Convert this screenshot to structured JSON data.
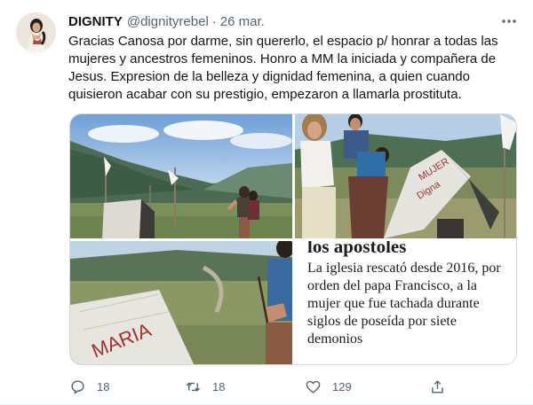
{
  "tweet": {
    "author_name": "DIGNITY",
    "author_handle": "@dignityrebel",
    "separator": "·",
    "date": "26 mar.",
    "text": "Gracias Canosa por darme, sin quererlo, el espacio p/ honrar a todas las\nmujeres y ancestros femeninos. Honro a MM la iniciada y compañera de\nJesus. Expresion de la belleza y dignidad femenina, a quien cuando\nquisieron acabar con su prestigio, empezaron a llamarla prostituta."
  },
  "media": {
    "photo2_sign_text": [
      "MUJER",
      "Digna"
    ],
    "photo3_sign_text": "MARIA",
    "article": {
      "header": "los apostoles",
      "body": "La iglesia rescató desde 2016, por orden del papa Francisco, a la mujer que fue tachada durante siglos de poseída por siete demonios"
    }
  },
  "actions": {
    "reply_count": "18",
    "retweet_count": "18",
    "like_count": "129"
  },
  "icons": [
    "more-icon",
    "reply-icon",
    "retweet-icon",
    "like-icon",
    "share-icon"
  ],
  "colors": {
    "text": "#0f1419",
    "secondary": "#536471",
    "border": "#cfd9de"
  }
}
